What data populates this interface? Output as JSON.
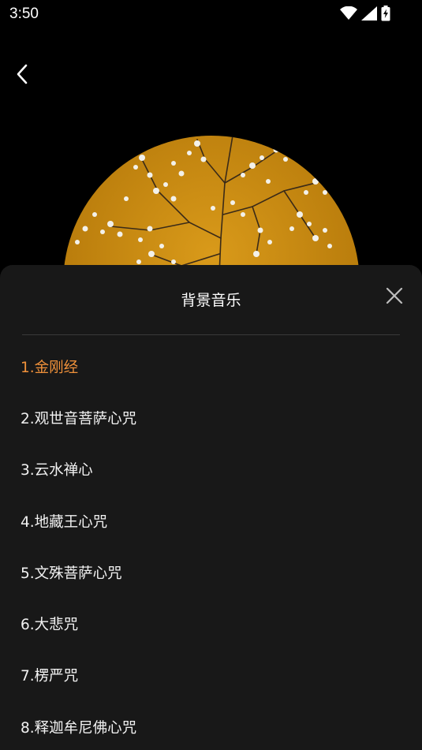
{
  "status_bar": {
    "time": "3:50",
    "icons": [
      "wifi-icon",
      "signal-icon",
      "battery-charging-icon"
    ]
  },
  "header": {
    "back_icon": "chevron-left-icon"
  },
  "sheet": {
    "title": "背景音乐",
    "close_icon": "close-icon",
    "accent_color": "#f0913a",
    "active_index": 0,
    "tracks": [
      "1.金刚经",
      "2.观世音菩萨心咒",
      "3.云水禅心",
      "4.地藏王心咒",
      "5.文殊菩萨心咒",
      "6.大悲咒",
      "7.楞严咒",
      "8.释迦牟尼佛心咒"
    ]
  }
}
